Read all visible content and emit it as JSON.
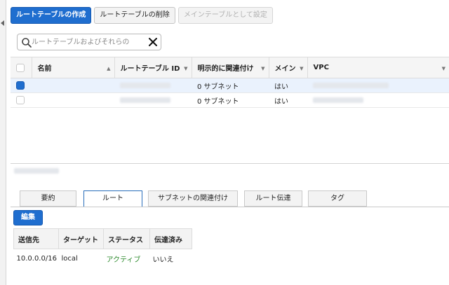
{
  "toolbar": {
    "create_label": "ルートテーブルの作成",
    "delete_label": "ルートテーブルの削除",
    "set_main_label": "メインテーブルとして設定"
  },
  "search": {
    "placeholder": "ルートテーブルおよびそれらの",
    "value": ""
  },
  "table": {
    "columns": [
      "名前",
      "ルートテーブル ID",
      "明示的に関連付け",
      "メイン",
      "VPC"
    ],
    "rows": [
      {
        "selected": true,
        "name": "",
        "subnets": "0 サブネット",
        "main": "はい"
      },
      {
        "selected": false,
        "name": "",
        "subnets": "0 サブネット",
        "main": "はい"
      }
    ]
  },
  "tabs": [
    "要約",
    "ルート",
    "サブネットの関連付け",
    "ルート伝達",
    "タグ"
  ],
  "active_tab": "ルート",
  "edit_label": "編集",
  "routes": {
    "columns": [
      "送信先",
      "ターゲット",
      "ステータス",
      "伝達済み"
    ],
    "rows": [
      {
        "destination": "10.0.0.0/16",
        "target": "local",
        "status": "アクティブ",
        "propagated": "いいえ"
      }
    ]
  },
  "colors": {
    "primary": "#1f6ecf",
    "active_status": "#2e8b2e",
    "selected_row": "#eaf2fd"
  }
}
